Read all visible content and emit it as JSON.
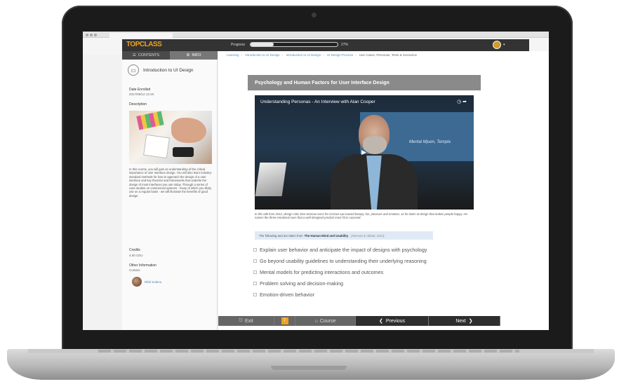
{
  "sidebar": {
    "tabs": [
      {
        "label": "CONTENTS",
        "icon": "list-icon"
      },
      {
        "label": "INFO",
        "icon": "gear-icon"
      }
    ],
    "course_title": "Introduction to UI Design",
    "date_enrolled_label": "Date Enrolled",
    "date_enrolled_value": "2017/09/12 13:19",
    "description_label": "Description",
    "description_text": "In this course, you will gain an understanding of the critical importance of user interface design. You will also learn industry-standard methods for how to approach the design of a user interface and key theories and frameworks that underlie the design of most interfaces you use today. Through a series of case studies on commercial systems - many of which you likely use on a regular basis - we will illustrate the benefits of good design.",
    "credits_label": "Credits",
    "credits_value": "4.00 CEU",
    "other_info_label": "Other Information",
    "contact_label": "Contact",
    "contact_name": "Rifal Soleno"
  },
  "header": {
    "logo_part1": "TOP",
    "logo_part2": "CLASS",
    "progress_label": "Progress",
    "progress_value": 0.27,
    "progress_text": "27%"
  },
  "main": {
    "breadcrumb": [
      "Learning",
      "Introduction to UI Design",
      "Introduction to UI Design",
      "UI Design Process",
      "Use Cases, Personas, Tests & Scenarios"
    ],
    "section_title": "Psychology and Human Factors for User Interface Design",
    "video_title": "Understanding Personas - An Interview with Alan Cooper",
    "video_bg_text": "Mental Mjuen, Templa",
    "caption": "In this talk from 2012, design critic Don Norman turns his incisive eye toward beauty, fun, pleasure and emotion, as he looks at design that makes people happy. He names the three emotional cues that a well-designed product must hit to succeed.",
    "info_prefix": "The following and are taken from",
    "info_source": "The Human Mind and Usability",
    "info_authors": "(Norman & Abbott, 2011).",
    "objectives": [
      "Explain user behavior and anticipate the impact of designs with psychology",
      "Go beyond usability guidelines to understanding their underlying reasoning",
      "Mental models for predicting interactions and outcomes",
      "Problem solving and decision-making",
      "Emotion-driven behavior"
    ]
  },
  "nav": {
    "exit_label": "Exit",
    "badge": "7",
    "course_label": "Course",
    "prev_label": "Previous",
    "next_label": "Next"
  },
  "colors": {
    "accent": "#f0a020",
    "link": "#4a90c8",
    "dark_bar": "#333333"
  }
}
